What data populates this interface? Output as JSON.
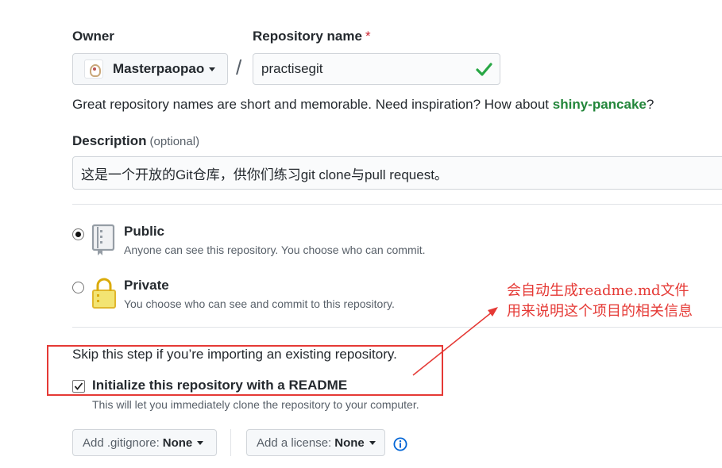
{
  "owner": {
    "label": "Owner",
    "value": "Masterpaopao"
  },
  "separator": "/",
  "repository": {
    "label": "Repository name",
    "required_mark": "*",
    "value": "practisegit"
  },
  "hint": {
    "prefix": "Great repository names are short and memorable. Need inspiration? How about ",
    "suggestion": "shiny-pancake",
    "suffix": "?"
  },
  "description": {
    "label": "Description",
    "optional": "(optional)",
    "value": "这是一个开放的Git仓库，供你们练习git clone与pull request。"
  },
  "visibility": {
    "public": {
      "title": "Public",
      "desc": "Anyone can see this repository. You choose who can commit.",
      "selected": true
    },
    "private": {
      "title": "Private",
      "desc": "You choose who can see and commit to this repository.",
      "selected": false
    }
  },
  "init": {
    "skip_text": "Skip this step if you’re importing an existing repository.",
    "readme_label": "Initialize this repository with a README",
    "readme_checked": true,
    "readme_note": "This will let you immediately clone the repository to your computer."
  },
  "gitignore": {
    "label": "Add .gitignore:",
    "value": "None"
  },
  "license": {
    "label": "Add a license:",
    "value": "None"
  },
  "annotation": {
    "line1": "会自动生成readme.md文件",
    "line2": "用来说明这个项目的相关信息",
    "color": "#e53935"
  },
  "colors": {
    "success": "#28a745",
    "suggestion": "#22863a",
    "info": "#0366d6",
    "required": "#cb2431"
  },
  "icons": {
    "valid": "check-icon",
    "public": "repo-book-icon",
    "private": "lock-icon",
    "info": "info-icon",
    "dropdown": "caret-down-icon"
  }
}
